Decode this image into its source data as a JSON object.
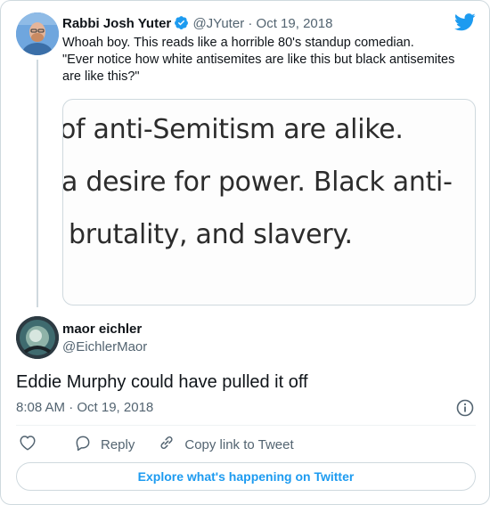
{
  "quoted_tweet": {
    "name": "Rabbi Josh Yuter",
    "handle": "@JYuter",
    "separator": "·",
    "date": "Oct 19, 2018",
    "text_line1": "Whoah boy. This reads like a horrible 80's standup comedian.",
    "text_line2": "\"Ever notice how white antisemites are like this but black antisemites are like this?\"",
    "image_text": [
      "of anti-Semitism are alike.",
      "a desire for power. Black anti-",
      "brutality, and slavery."
    ]
  },
  "tweet": {
    "name": "maor eichler",
    "handle": "@EichlerMaor",
    "text": "Eddie Murphy could have pulled it off",
    "timestamp": "8:08 AM · Oct 19, 2018"
  },
  "actions": {
    "reply": "Reply",
    "copy_link": "Copy link to Tweet"
  },
  "explore_button": "Explore what's happening on Twitter",
  "colors": {
    "twitter_blue": "#1d9bf0",
    "text_secondary": "#536471",
    "border": "#cfd9de"
  },
  "icons": [
    "verified-badge-icon",
    "twitter-bird-icon",
    "info-icon",
    "heart-icon",
    "reply-icon",
    "link-icon"
  ]
}
